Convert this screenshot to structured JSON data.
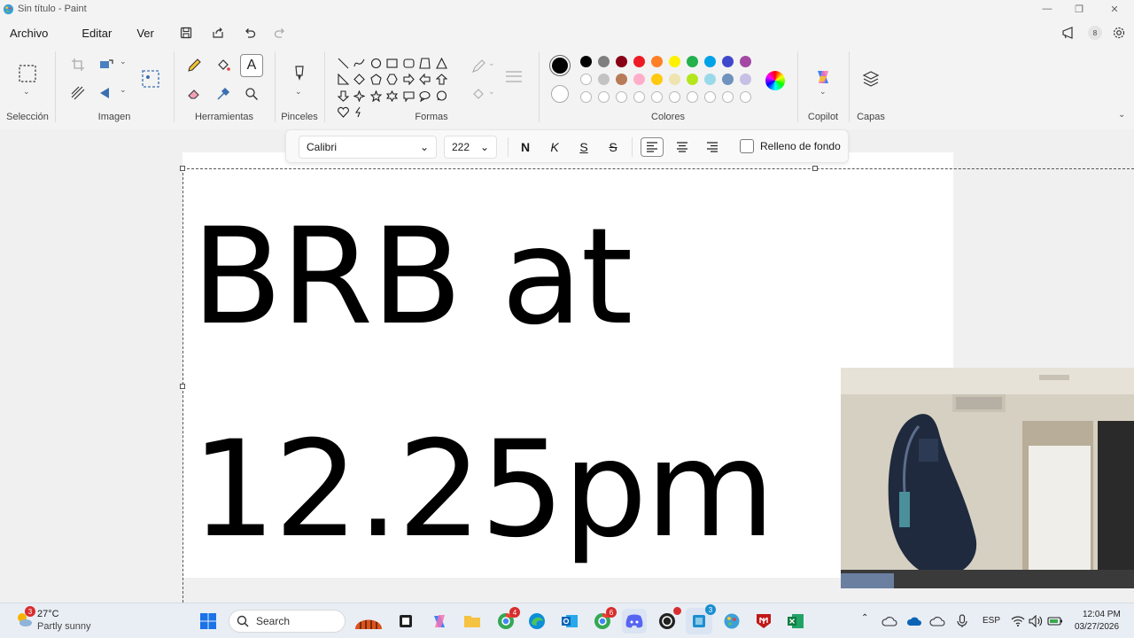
{
  "window": {
    "title": "Sin título - Paint"
  },
  "menu": {
    "file": "Archivo",
    "edit": "Editar",
    "view": "Ver",
    "notification_count": "8"
  },
  "ribbon": {
    "groups": {
      "selection": "Selección",
      "image": "Imagen",
      "tools": "Herramientas",
      "brushes": "Pinceles",
      "shapes": "Formas",
      "colors": "Colores",
      "copilot": "Copilot",
      "layers": "Capas"
    },
    "palette_row1": [
      "#000000",
      "#7f7f7f",
      "#880015",
      "#ed1c24",
      "#ff7f27",
      "#fff200",
      "#22b14c",
      "#00a2e8",
      "#3f48cc",
      "#a349a4"
    ],
    "palette_row2": [
      "#ffffff",
      "#c3c3c3",
      "#b97a57",
      "#ffaec9",
      "#ffc90e",
      "#efe4b0",
      "#b5e61d",
      "#99d9ea",
      "#7092be",
      "#c8bfe7"
    ],
    "primary_color": "#000000",
    "secondary_color": "#ffffff"
  },
  "text_toolbar": {
    "font_family": "Calibri",
    "font_size": "222",
    "bold": "N",
    "italic": "K",
    "underline": "S",
    "strikethrough": "S",
    "background_fill": "Relleno de fondo"
  },
  "canvas": {
    "line1": "BRB at",
    "line2": "12.25pm"
  },
  "taskbar": {
    "weather_temp": "27°C",
    "weather_desc": "Partly sunny",
    "weather_badge": "3",
    "search_placeholder": "Search",
    "badges": {
      "chrome": "4",
      "chrome2": "6",
      "teams": "3"
    },
    "language": "ESP",
    "time": "12:04 PM",
    "date": "03/27/2026"
  }
}
